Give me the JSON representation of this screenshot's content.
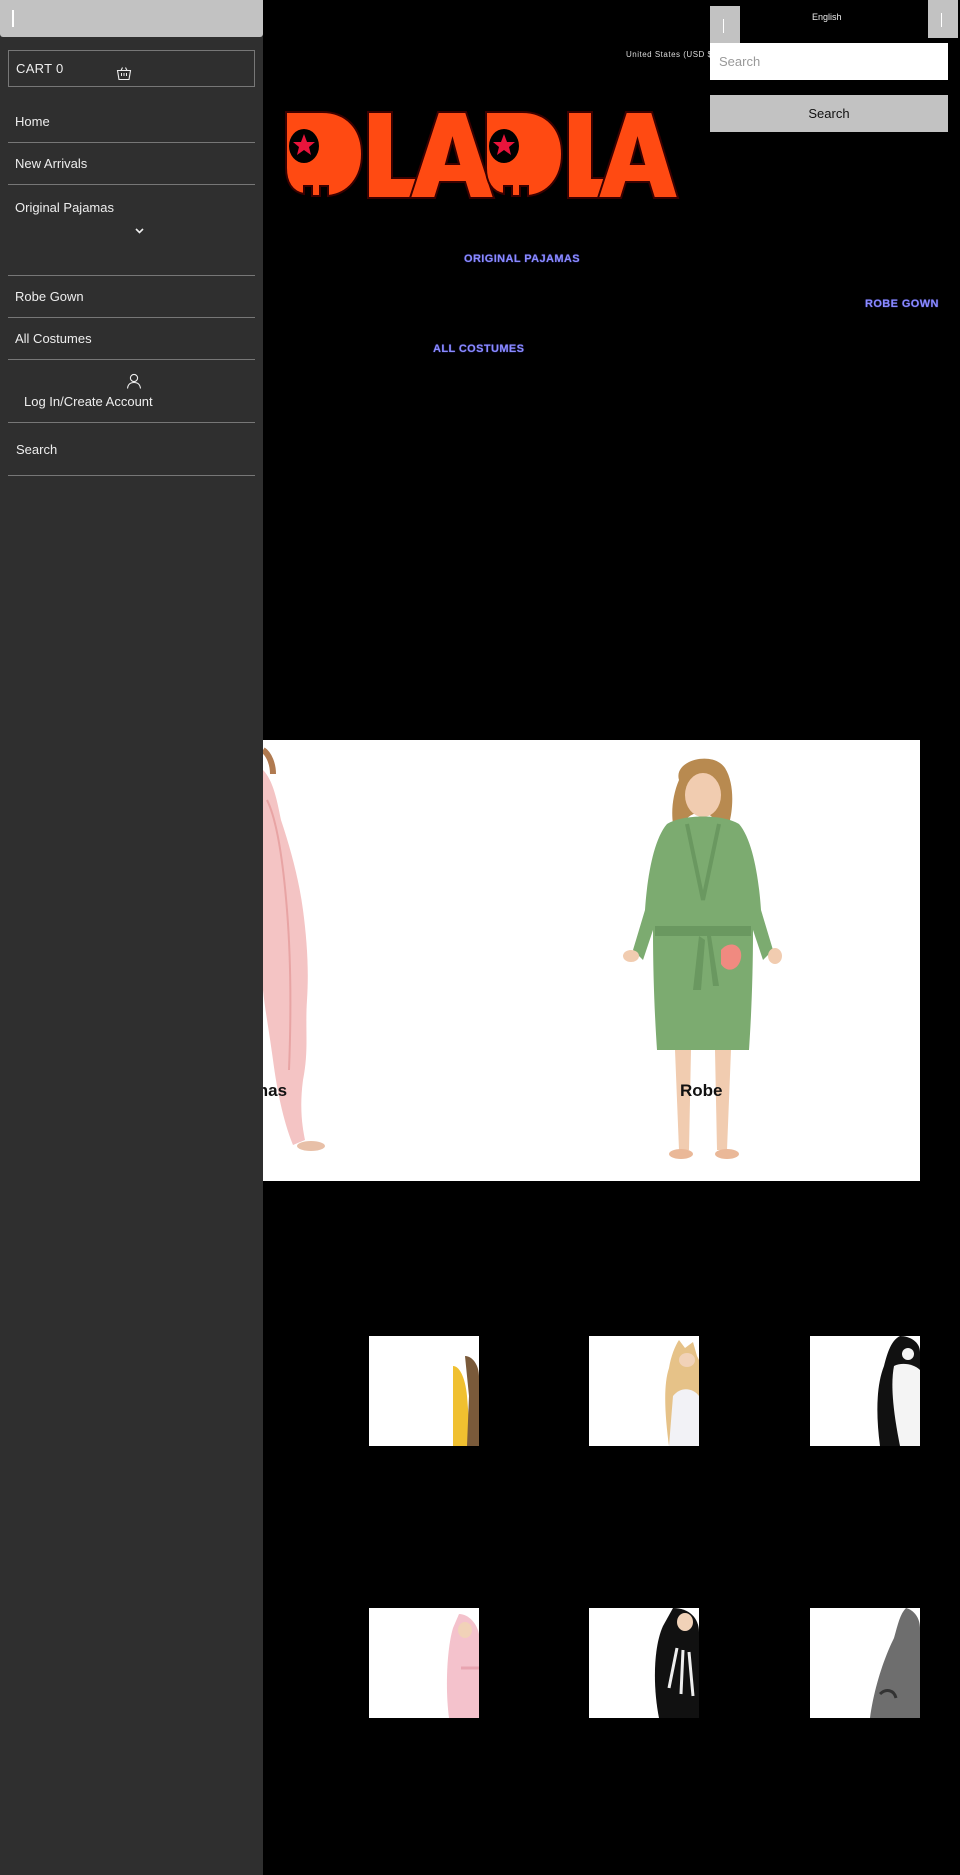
{
  "drawer": {
    "cart_label": "CART 0",
    "nav": {
      "home": "Home",
      "new_arrivals": "New Arrivals",
      "original_pajamas": "Original Pajamas",
      "robe_gown": "Robe Gown",
      "all_costumes": "All Costumes"
    },
    "login_label": "Log In/Create Account",
    "search_label": "Search"
  },
  "header": {
    "country": "United States (USD $)",
    "language": "English",
    "search_placeholder": "Search",
    "search_button": "Search",
    "logo_text": "DLADLA"
  },
  "main_nav": {
    "original_pajamas": "ORIGINAL PAJAMAS",
    "robe_gown": "ROBE GOWN",
    "all_costumes": "ALL COSTUMES"
  },
  "hero": {
    "pajamas_label": "mas",
    "robe_label": "Robe"
  },
  "colors": {
    "logo_orange": "#ff4a12",
    "logo_star": "#e8143c",
    "drawer_bg": "#2f2f2f",
    "link_blue": "#8a8aff"
  }
}
